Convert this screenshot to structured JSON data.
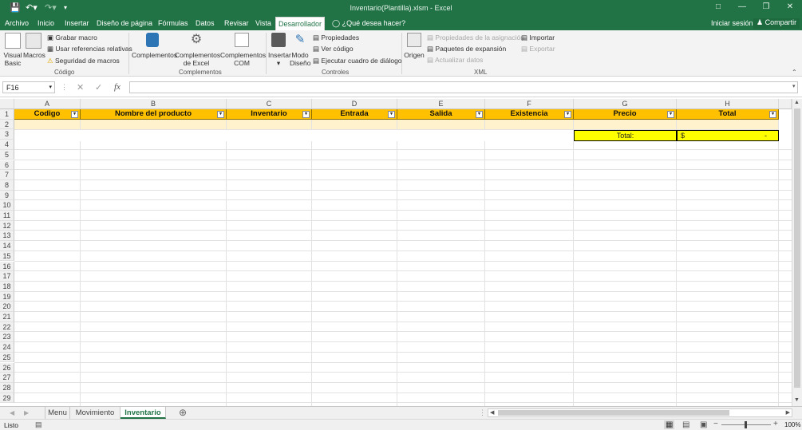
{
  "window": {
    "title": "Inventario(Plantilla).xlsm - Excel"
  },
  "tabs": [
    "Archivo",
    "Inicio",
    "Insertar",
    "Diseño de página",
    "Fórmulas",
    "Datos",
    "Revisar",
    "Vista",
    "Desarrollador"
  ],
  "tell_me": "¿Qué desea hacer?",
  "account": {
    "signin": "Iniciar sesión",
    "share": "Compartir"
  },
  "ribbon": {
    "codigo": {
      "visual_basic_1": "Visual",
      "visual_basic_2": "Basic",
      "macros": "Macros",
      "grabar": "Grabar macro",
      "relativas": "Usar referencias relativas",
      "seguridad": "Seguridad de macros",
      "label": "Código"
    },
    "complementos": {
      "compl": "Complementos",
      "excel_1": "Complementos",
      "excel_2": "de Excel",
      "com_1": "Complementos",
      "com_2": "COM",
      "label": "Complementos"
    },
    "controles": {
      "insertar": "Insertar",
      "modo_1": "Modo",
      "modo_2": "Diseño",
      "propiedades": "Propiedades",
      "ver_codigo": "Ver código",
      "ejecutar": "Ejecutar cuadro de diálogo",
      "label": "Controles"
    },
    "xml": {
      "origen": "Origen",
      "prop_asig": "Propiedades de la asignación",
      "paquetes": "Paquetes de expansión",
      "actualizar": "Actualizar datos",
      "importar": "Importar",
      "exportar": "Exportar",
      "label": "XML"
    }
  },
  "formula_bar": {
    "name_box": "F16",
    "fx": "fx",
    "value": ""
  },
  "columns": [
    "A",
    "B",
    "C",
    "D",
    "E",
    "F",
    "G",
    "H"
  ],
  "headers": [
    "Codigo",
    "Nombre del producto",
    "Inventario",
    "Entrada",
    "Salida",
    "Existencia",
    "Precio",
    "Total"
  ],
  "total_row": {
    "label": "Total:",
    "currency": "$",
    "value": "-"
  },
  "rows": [
    "1",
    "2",
    "3",
    "4",
    "5",
    "6",
    "7",
    "8",
    "9",
    "10",
    "11",
    "12",
    "13",
    "14",
    "15",
    "16",
    "17",
    "18",
    "19",
    "20",
    "21",
    "22",
    "23",
    "24",
    "25",
    "26",
    "27",
    "28",
    "29"
  ],
  "sheets": [
    "Menu",
    "Movimiento",
    "Inventario"
  ],
  "active_sheet": "Inventario",
  "status": {
    "ready": "Listo",
    "zoom": "100%"
  },
  "colors": {
    "excel_green": "#217346",
    "header_fill": "#ffc000",
    "row_fill": "#fff2cc",
    "total_fill": "#ffff00"
  }
}
